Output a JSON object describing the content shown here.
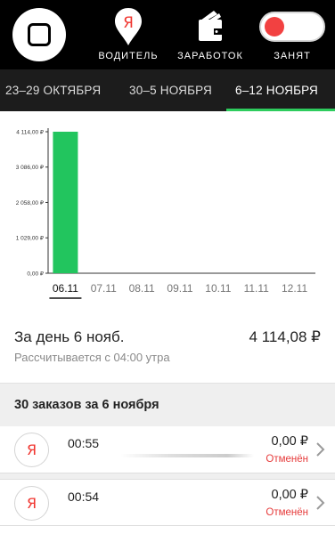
{
  "topbar": {
    "home_icon": "square-stop-icon",
    "driver": {
      "label": "ВОДИТЕЛЬ",
      "icon": "yandex-pin-icon",
      "glyph": "Я"
    },
    "earnings": {
      "label": "ЗАРАБОТОК",
      "icon": "wallet-icon"
    },
    "busy": {
      "label": "ЗАНЯТ",
      "icon": "toggle-switch",
      "state": "busy"
    }
  },
  "tabs": [
    {
      "label": "23–29 ОКТЯБРЯ",
      "active": false
    },
    {
      "label": "30–5 НОЯБРЯ",
      "active": false
    },
    {
      "label": "6–12 НОЯБРЯ",
      "active": true
    }
  ],
  "colors": {
    "accent": "#2ecc5d",
    "bar": "#22c55e",
    "status_cancelled": "#e63b3b",
    "brand_red": "#f0352f",
    "busy_knob": "#f24141"
  },
  "chart_data": {
    "type": "bar",
    "categories": [
      "06.11",
      "07.11",
      "08.11",
      "09.11",
      "10.11",
      "11.11",
      "12.11"
    ],
    "values": [
      4114.08,
      0,
      0,
      0,
      0,
      0,
      0
    ],
    "y_ticks": [
      "0,00 ₽",
      "1 029,00 ₽",
      "2 058,00 ₽",
      "3 086,00 ₽",
      "4 114,00 ₽"
    ],
    "y_tick_values": [
      0,
      1029,
      2058,
      3086,
      4114
    ],
    "ylim": [
      0,
      4114
    ],
    "selected_category": "06.11",
    "grid": false
  },
  "summary": {
    "title": "За день 6 нояб.",
    "value": "4 114,08 ₽",
    "subtitle": "Рассчитывается с 04:00 утра"
  },
  "orders": {
    "header": "30 заказов за 6 ноября",
    "items": [
      {
        "icon": "yandex-logo-icon",
        "glyph": "Я",
        "time": "00:55",
        "sum": "0,00 ₽",
        "status": "Отменён"
      },
      {
        "icon": "yandex-logo-icon",
        "glyph": "Я",
        "time": "00:54",
        "sum": "0,00 ₽",
        "status": "Отменён"
      }
    ]
  }
}
